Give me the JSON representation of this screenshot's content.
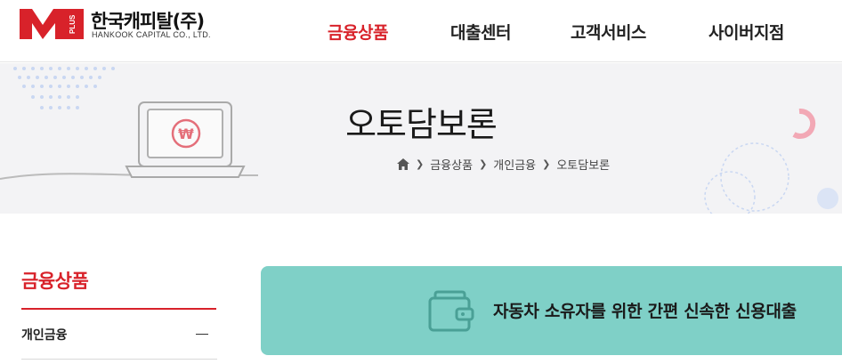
{
  "header": {
    "logo": {
      "mark_text": "M",
      "mark_sub": "PLUS",
      "name_ko": "한국캐피탈(주)",
      "name_en": "HANKOOK CAPITAL CO., LTD."
    },
    "nav": [
      {
        "label": "금융상품",
        "active": true
      },
      {
        "label": "대출센터",
        "active": false
      },
      {
        "label": "고객서비스",
        "active": false
      },
      {
        "label": "사이버지점",
        "active": false
      }
    ]
  },
  "banner": {
    "title": "오토담보론",
    "breadcrumb": [
      "금융상품",
      "개인금융",
      "오토담보론"
    ],
    "icon_symbol": "₩"
  },
  "side": {
    "title": "금융상품",
    "items": [
      {
        "label": "개인금융"
      }
    ]
  },
  "info": {
    "text": "자동차 소유자를 위한 간편 신속한 신용대출"
  },
  "colors": {
    "brand_red": "#d8222a",
    "banner_bg": "#f3f3f5",
    "info_bg": "#7fd0c7"
  }
}
